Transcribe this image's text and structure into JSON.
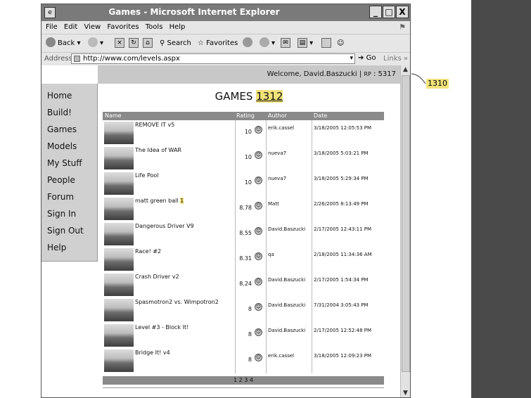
{
  "window": {
    "title": "Games - Microsoft Internet Explorer",
    "controls": {
      "minimize": "_",
      "maximize": "□",
      "close": "X"
    }
  },
  "menu": [
    "File",
    "Edit",
    "View",
    "Favorites",
    "Tools",
    "Help"
  ],
  "toolbar": {
    "back": "Back",
    "search": "Search",
    "favorites": "Favorites"
  },
  "address": {
    "label": "Address",
    "url": "http://www.com/levels.aspx",
    "go": "Go",
    "links": "Links"
  },
  "header": {
    "welcome": "Welcome, David.Baszucki",
    "separator": "|",
    "rp_label": "RP",
    "rp_value": ": 5317"
  },
  "nav": [
    "Home",
    "Build!",
    "Games",
    "Models",
    "My Stuff",
    "People",
    "Forum",
    "Sign In",
    "Sign Out",
    "Help"
  ],
  "page": {
    "title": "GAMES",
    "ref": "1312"
  },
  "table": {
    "headers": [
      "Name",
      "Rating",
      "Author",
      "Date"
    ],
    "rows": [
      {
        "name": "REMOVE IT v5",
        "tag": "",
        "rating": "10",
        "author": "erik.cassel",
        "date": "3/18/2005 12:05:53 PM"
      },
      {
        "name": "The Idea of WAR",
        "tag": "",
        "rating": "10",
        "author": "nueva7",
        "date": "3/18/2005 5:03:21 PM"
      },
      {
        "name": "Life Pool",
        "tag": "",
        "rating": "10",
        "author": "nueva7",
        "date": "3/18/2005 5:29:34 PM"
      },
      {
        "name": "matt green ball",
        "tag": "1",
        "rating": "8.78",
        "author": "Matt",
        "date": "2/26/2005 8:13:49 PM"
      },
      {
        "name": "Dangerous Driver V9",
        "tag": "",
        "rating": "8.55",
        "author": "David.Baszucki",
        "date": "2/17/2005 12:43:11 PM"
      },
      {
        "name": "Race! #2",
        "tag": "",
        "rating": "8.31",
        "author": "qa",
        "date": "2/18/2005 11:34:36 AM"
      },
      {
        "name": "Crash Driver v2",
        "tag": "",
        "rating": "8.24",
        "author": "David.Baszucki",
        "date": "2/17/2005 1:54:34 PM"
      },
      {
        "name": "Spasmotron2 vs. Wimpotron2",
        "tag": "",
        "rating": "8",
        "author": "David.Baszucki",
        "date": "7/31/2004 3:05:43 PM"
      },
      {
        "name": "Level #3 - Block It!",
        "tag": "",
        "rating": "8",
        "author": "David.Baszucki",
        "date": "2/17/2005 12:52:48 PM"
      },
      {
        "name": "Bridge It! v4",
        "tag": "",
        "rating": "8",
        "author": "erik.cassel",
        "date": "3/18/2005 12:09:23 PM"
      }
    ]
  },
  "pager": "1 2 3 4",
  "annotation": "1310",
  "colors": {
    "highlight": "#f2e27a",
    "table_header": "#8a8a8a",
    "nav_bg": "#d0d0d0"
  }
}
